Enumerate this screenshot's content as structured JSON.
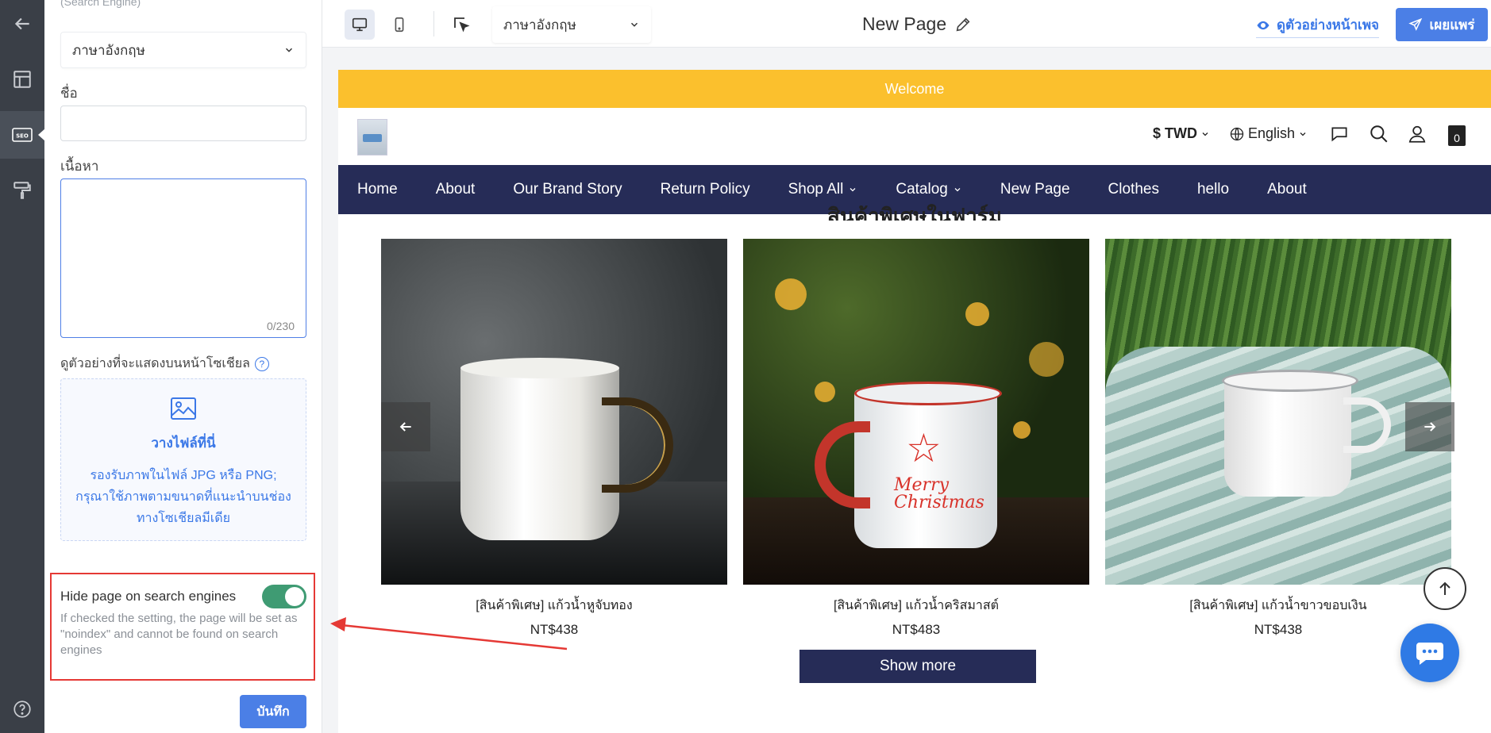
{
  "panel": {
    "cut_label": "(Search Engine)",
    "language_value": "ภาษาอังกฤษ",
    "title_label": "ชื่อ",
    "title_value": "",
    "content_label": "เนื้อหา",
    "content_value": "",
    "content_counter": "0/230",
    "social_preview_label": "ดูตัวอย่างที่จะแสดงบนหน้าโซเชียล",
    "help_glyph": "?",
    "dropzone_title": "วางไฟล์ที่นี่",
    "dropzone_line1": "รองรับภาพในไฟล์ JPG หรือ PNG;",
    "dropzone_line2": "กรุณาใช้ภาพตามขนาดที่แนะนำบนช่อง",
    "dropzone_line3": "ทางโซเชียลมีเดีย",
    "hide_label": "Hide page on search engines",
    "hide_enabled": true,
    "hide_desc": "If checked the setting, the page will be set as \"noindex\" and cannot be found on search engines",
    "save_label": "บันทึก"
  },
  "toolbar": {
    "language_value": "ภาษาอังกฤษ",
    "page_title": "New Page",
    "preview_label": "ดูตัวอย่างหน้าเพจ",
    "publish_label": "เผยแพร่"
  },
  "store": {
    "welcome": "Welcome",
    "currency": "$ TWD",
    "language": "English",
    "cart_count": "0",
    "nav": [
      {
        "label": "Home",
        "dropdown": false
      },
      {
        "label": "About",
        "dropdown": false
      },
      {
        "label": "Our Brand Story",
        "dropdown": false
      },
      {
        "label": "Return Policy",
        "dropdown": false
      },
      {
        "label": "Shop All",
        "dropdown": true
      },
      {
        "label": "Catalog",
        "dropdown": true
      },
      {
        "label": "New Page",
        "dropdown": false
      },
      {
        "label": "Clothes",
        "dropdown": false
      },
      {
        "label": "hello",
        "dropdown": false
      },
      {
        "label": "About",
        "dropdown": false
      }
    ],
    "section_title": "สินค้าพิเศษในฟาร์ม",
    "products": [
      {
        "name": "[สินค้าพิเศษ] แก้วน้ำหูจับทอง",
        "price": "NT$438"
      },
      {
        "name": "[สินค้าพิเศษ] แก้วน้ำคริสมาสต์",
        "price": "NT$483"
      },
      {
        "name": "[สินค้าพิเศษ] แก้วน้ำขาวขอบเงิน",
        "price": "NT$438"
      }
    ],
    "mug_text": "Merry Christmas",
    "show_more": "Show more"
  },
  "colors": {
    "accent": "#4b7fe6",
    "welcome_bar": "#fbc02d",
    "nav_bar": "#262c57",
    "toggle_on": "#3f9b73",
    "annotation": "#e53935"
  }
}
